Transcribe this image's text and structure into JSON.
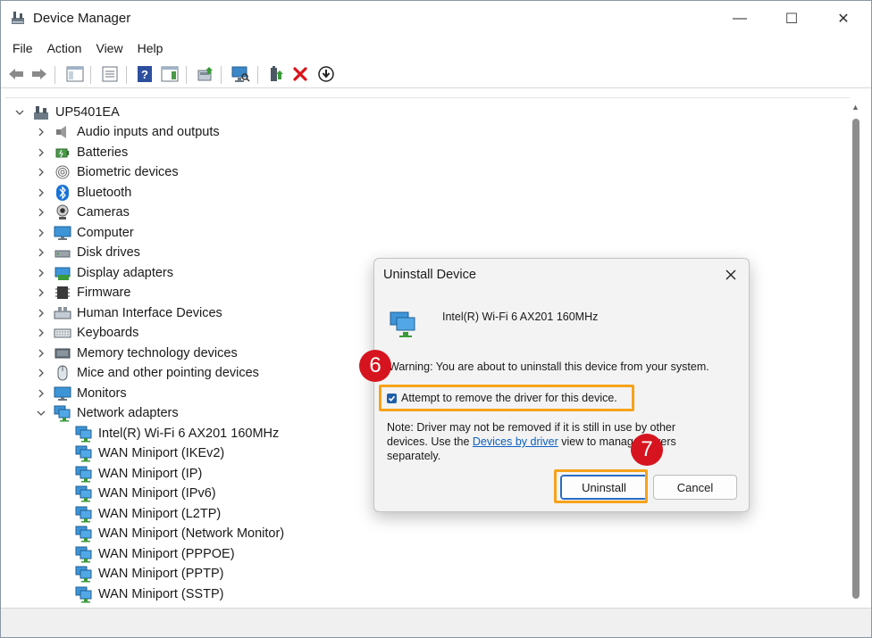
{
  "window": {
    "title": "Device Manager"
  },
  "window_controls": {
    "minimize": "—",
    "maximize": "☐",
    "close": "✕"
  },
  "menu": [
    "File",
    "Action",
    "View",
    "Help"
  ],
  "tree": {
    "root": "UP5401EA",
    "categories": [
      {
        "label": "Audio inputs and outputs",
        "icon": "speaker-icon"
      },
      {
        "label": "Batteries",
        "icon": "battery-icon"
      },
      {
        "label": "Biometric devices",
        "icon": "fingerprint-icon"
      },
      {
        "label": "Bluetooth",
        "icon": "bluetooth-icon"
      },
      {
        "label": "Cameras",
        "icon": "camera-icon"
      },
      {
        "label": "Computer",
        "icon": "monitor-icon"
      },
      {
        "label": "Disk drives",
        "icon": "disk-drive-icon"
      },
      {
        "label": "Display adapters",
        "icon": "display-adapter-icon"
      },
      {
        "label": "Firmware",
        "icon": "chip-icon"
      },
      {
        "label": "Human Interface Devices",
        "icon": "hid-icon"
      },
      {
        "label": "Keyboards",
        "icon": "keyboard-icon"
      },
      {
        "label": "Memory technology devices",
        "icon": "memory-icon"
      },
      {
        "label": "Mice and other pointing devices",
        "icon": "mouse-icon"
      },
      {
        "label": "Monitors",
        "icon": "monitor-icon"
      },
      {
        "label": "Network adapters",
        "icon": "network-icon"
      }
    ],
    "network_children": [
      "Intel(R) Wi-Fi 6 AX201 160MHz",
      "WAN Miniport (IKEv2)",
      "WAN Miniport (IP)",
      "WAN Miniport (IPv6)",
      "WAN Miniport (L2TP)",
      "WAN Miniport (Network Monitor)",
      "WAN Miniport (PPPOE)",
      "WAN Miniport (PPTP)",
      "WAN Miniport (SSTP)"
    ]
  },
  "dialog": {
    "title": "Uninstall Device",
    "device_name": "Intel(R) Wi-Fi 6 AX201 160MHz",
    "warning": "Warning: You are about to uninstall this device from your system.",
    "checkbox_label": "Attempt to remove the driver for this device.",
    "checkbox_checked": true,
    "note_part1": "Note: Driver may not be removed if it is still in use by other devices. Use the ",
    "note_link": "Devices by driver",
    "note_part2": " view to manage drivers separately.",
    "uninstall_label": "Uninstall",
    "cancel_label": "Cancel"
  },
  "annotations": {
    "step_checkbox": "6",
    "step_uninstall": "7"
  },
  "colors": {
    "highlight": "#f6a21b",
    "badge": "#d6141f",
    "link": "#0b5fc2"
  }
}
